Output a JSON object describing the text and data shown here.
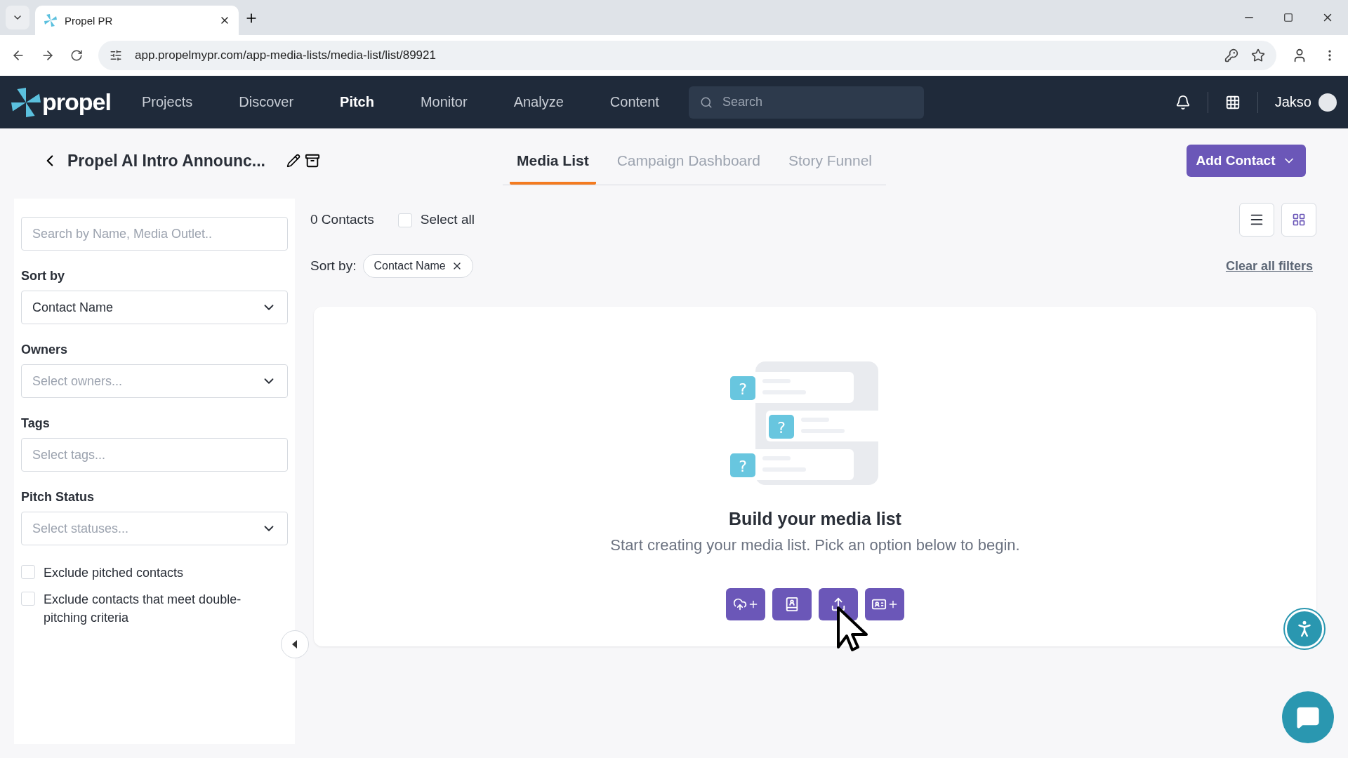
{
  "browser": {
    "tab_title": "Propel PR",
    "url": "app.propelmypr.com/app-media-lists/media-list/list/89921"
  },
  "nav": {
    "logo": "propel",
    "items": [
      {
        "label": "Projects",
        "selected": false
      },
      {
        "label": "Discover",
        "selected": false
      },
      {
        "label": "Pitch",
        "selected": true
      },
      {
        "label": "Monitor",
        "selected": false
      },
      {
        "label": "Analyze",
        "selected": false
      },
      {
        "label": "Content",
        "selected": false
      }
    ],
    "search_placeholder": "Search",
    "user": "Jakso"
  },
  "header": {
    "title": "Propel AI Intro Announc...",
    "tabs": [
      {
        "label": "Media List",
        "selected": true
      },
      {
        "label": "Campaign Dashboard",
        "selected": false
      },
      {
        "label": "Story Funnel",
        "selected": false
      }
    ],
    "add_button": "Add Contact"
  },
  "sidebar": {
    "search_placeholder": "Search by Name, Media Outlet..",
    "filters": [
      {
        "label": "Sort by",
        "kind": "dropdown",
        "value": "Contact Name"
      },
      {
        "label": "Owners",
        "kind": "dropdown",
        "placeholder": "Select owners..."
      },
      {
        "label": "Tags",
        "kind": "text",
        "placeholder": "Select tags..."
      },
      {
        "label": "Pitch Status",
        "kind": "dropdown",
        "placeholder": "Select statuses..."
      }
    ],
    "checkboxes": [
      {
        "label": "Exclude pitched contacts",
        "checked": false
      },
      {
        "label": "Exclude contacts that meet double-pitching criteria",
        "checked": false
      }
    ]
  },
  "main": {
    "count": "0 Contacts",
    "select_all": {
      "label": "Select all",
      "checked": false
    },
    "sort_label": "Sort by:",
    "sort_chip": "Contact Name",
    "clear": "Clear all filters",
    "views": [
      {
        "kind": "list",
        "selected": false
      },
      {
        "kind": "grid",
        "selected": true
      }
    ],
    "empty": {
      "illustration_marks": [
        "?",
        "?",
        "?"
      ],
      "title": "Build your media list",
      "subtitle": "Start creating your media list. Pick an option below to begin.",
      "actions": [
        {
          "kind": "cloud"
        },
        {
          "kind": "contacts"
        },
        {
          "kind": "upload"
        },
        {
          "kind": "card"
        }
      ]
    }
  }
}
